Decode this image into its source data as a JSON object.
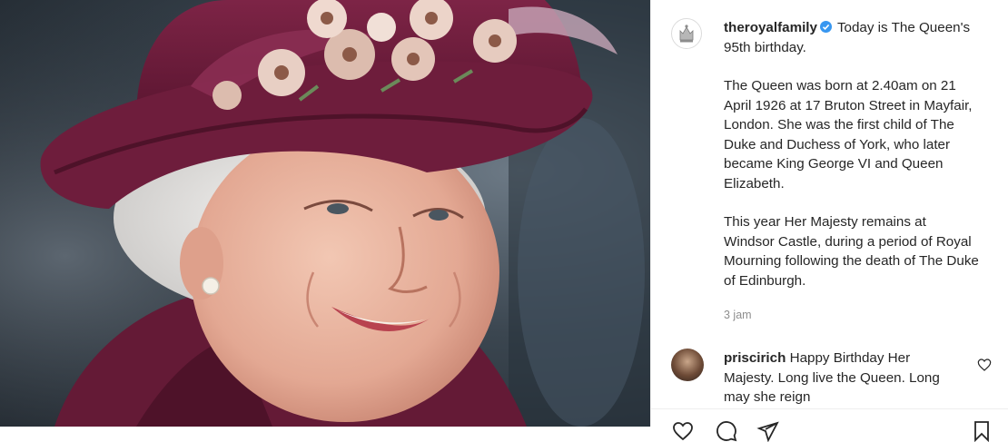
{
  "post": {
    "username": "theroyalfamily",
    "caption_lead": "Today is The Queen's 95th birthday.",
    "paragraphs": [
      "The Queen was born at 2.40am on 21 April 1926 at 17 Bruton Street in Mayfair, London. She was the first child of The Duke and Duchess of York, who later became King George VI and Queen Elizabeth.",
      "This year Her Majesty remains at Windsor Castle, during a period of Royal Mourning following the death of The Duke of Edinburgh."
    ],
    "timestamp": "3 jam"
  },
  "comment": {
    "username": "priscirich",
    "text": "Happy Birthday Her Majesty. Long live the Queen. Long may she reign"
  },
  "icons": {
    "verified": "verified-badge-icon",
    "like": "heart-icon",
    "comment": "comment-icon",
    "share": "share-icon",
    "save": "bookmark-icon"
  },
  "colors": {
    "verified": "#3897f0",
    "hat": "#6e1d3c",
    "text": "#262626",
    "muted": "#8e8e8e"
  }
}
